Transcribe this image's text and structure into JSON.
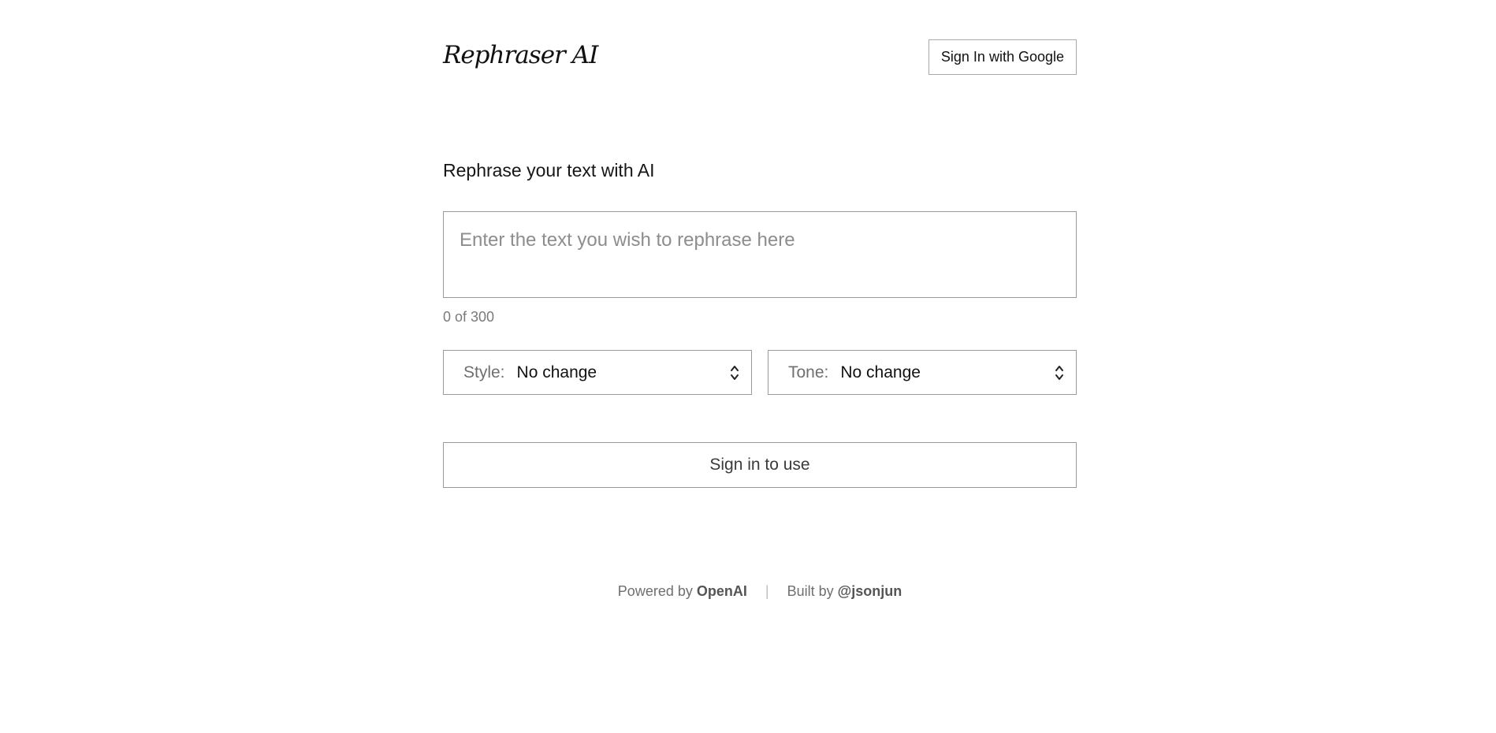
{
  "header": {
    "logo": "Rephraser AI",
    "signin_button": "Sign In with Google"
  },
  "main": {
    "title": "Rephrase your text with AI",
    "input": {
      "placeholder": "Enter the text you wish to rephrase here",
      "value": ""
    },
    "counter": "0 of 300",
    "style_select": {
      "label": "Style:",
      "value": "No change"
    },
    "tone_select": {
      "label": "Tone:",
      "value": "No change"
    },
    "submit_button": "Sign in to use"
  },
  "footer": {
    "powered_prefix": "Powered by",
    "powered_link": "OpenAI",
    "separator": "|",
    "built_prefix": "Built by",
    "built_link": "@jsonjun"
  },
  "icons": {
    "select_chevron": "chevron-up-down-icon"
  }
}
